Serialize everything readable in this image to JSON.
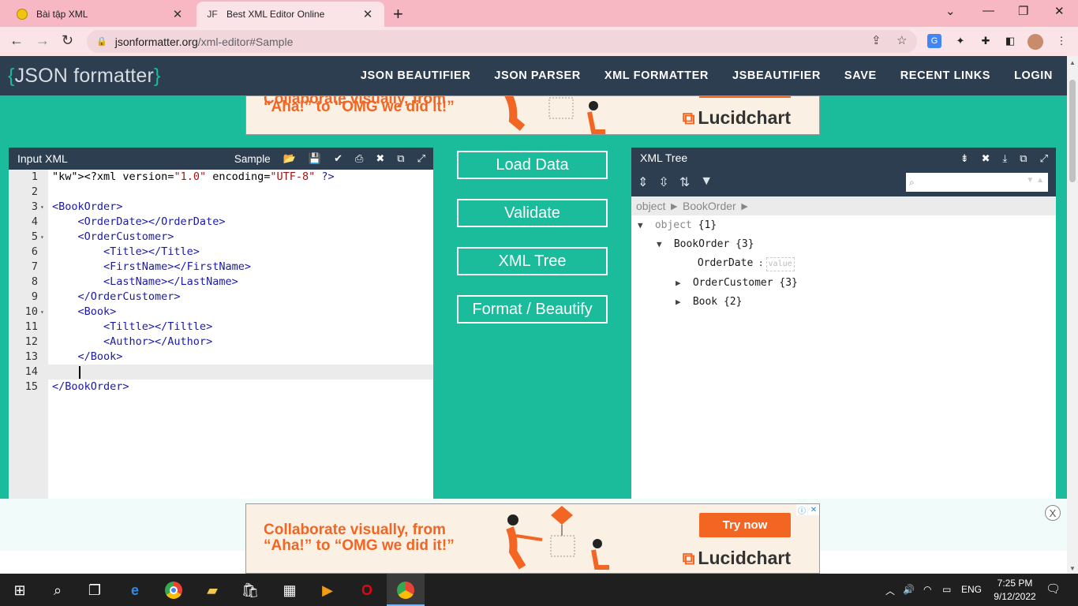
{
  "browser": {
    "tabs": [
      {
        "label": "Bài tập XML",
        "active": false,
        "icon": "smiley-favicon"
      },
      {
        "label": "Best XML Editor Online",
        "active": true,
        "icon": "jf-favicon"
      }
    ],
    "favicon_text": "JF",
    "close_glyph": "✕",
    "newtab_glyph": "+",
    "url_host": "jsonformatter.org",
    "url_path": "/xml-editor#Sample"
  },
  "site": {
    "logo_open": "{",
    "logo_text": "JSON formatter",
    "logo_close": "}",
    "nav": [
      "JSON BEAUTIFIER",
      "JSON PARSER",
      "XML FORMATTER",
      "JSBEAUTIFIER",
      "SAVE",
      "RECENT LINKS",
      "LOGIN"
    ]
  },
  "ad": {
    "line1": "Collaborate visually, from",
    "line2": "“Aha!” to “OMG we did it!”",
    "brand": "Lucidchart",
    "cta": "Try now",
    "close": "X"
  },
  "input_panel": {
    "title": "Input XML",
    "sample_label": "Sample",
    "lines": [
      {
        "n": "1",
        "fold": "",
        "text": "<?xml version=\"1.0\" encoding=\"UTF-8\" ?>"
      },
      {
        "n": "2",
        "fold": "",
        "text": ""
      },
      {
        "n": "3",
        "fold": "▾",
        "text": "<BookOrder>"
      },
      {
        "n": "4",
        "fold": "",
        "text": "    <OrderDate></OrderDate>"
      },
      {
        "n": "5",
        "fold": "▾",
        "text": "    <OrderCustomer>"
      },
      {
        "n": "6",
        "fold": "",
        "text": "        <Title></Title>"
      },
      {
        "n": "7",
        "fold": "",
        "text": "        <FirstName></FirstName>"
      },
      {
        "n": "8",
        "fold": "",
        "text": "        <LastName></LastName>"
      },
      {
        "n": "9",
        "fold": "",
        "text": "    </OrderCustomer>"
      },
      {
        "n": "10",
        "fold": "▾",
        "text": "    <Book>"
      },
      {
        "n": "11",
        "fold": "",
        "text": "        <Tiltle></Tiltle>"
      },
      {
        "n": "12",
        "fold": "",
        "text": "        <Author></Author>"
      },
      {
        "n": "13",
        "fold": "",
        "text": "    </Book>"
      },
      {
        "n": "14",
        "fold": "",
        "text": ""
      },
      {
        "n": "15",
        "fold": "",
        "text": "</BookOrder>"
      }
    ],
    "active_line": "14"
  },
  "actions": [
    "Load Data",
    "Validate",
    "XML Tree",
    "Format / Beautify"
  ],
  "tree_panel": {
    "title": "XML Tree",
    "breadcrumb": "object ► BookOrder ►",
    "search_placeholder": "",
    "rows": [
      {
        "tri": "▼",
        "key": "object",
        "count": "{1}",
        "gray": true
      },
      {
        "tri": "▼",
        "key": "BookOrder",
        "count": "{3}",
        "gray": false
      },
      {
        "tri": "",
        "key": "OrderDate",
        "count": "",
        "gray": false,
        "value_placeholder": "value"
      },
      {
        "tri": "▶",
        "key": "OrderCustomer",
        "count": "{3}",
        "gray": false
      },
      {
        "tri": "▶",
        "key": "Book",
        "count": "{2}",
        "gray": false
      }
    ]
  },
  "taskbar": {
    "time": "7:25 PM",
    "date": "9/12/2022",
    "lang": "ENG"
  }
}
